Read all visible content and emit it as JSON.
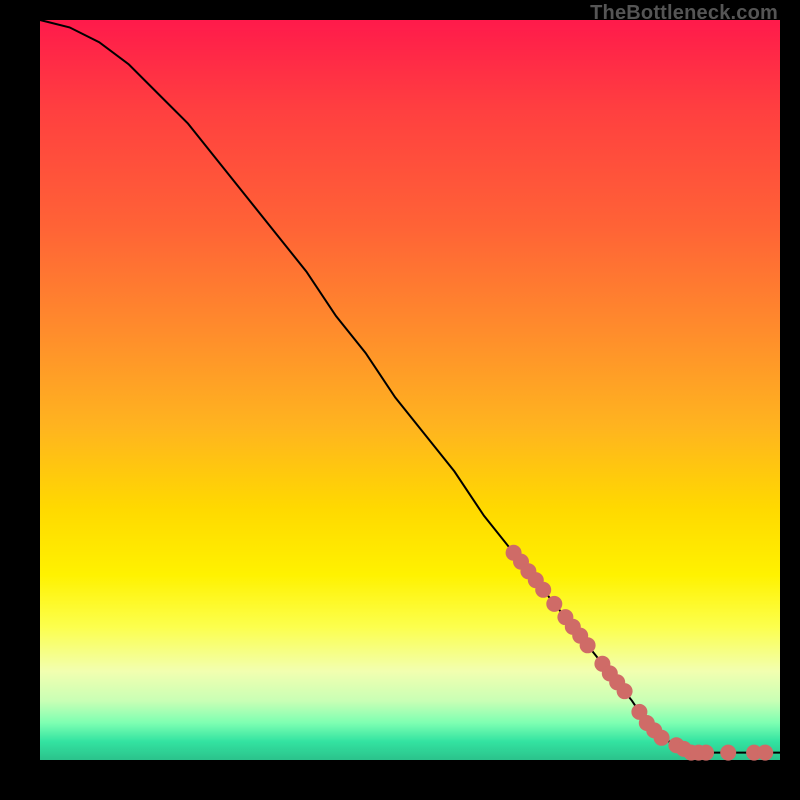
{
  "attribution": "TheBottleneck.com",
  "chart_data": {
    "type": "line",
    "title": "",
    "xlabel": "",
    "ylabel": "",
    "xlim": [
      0,
      100
    ],
    "ylim": [
      0,
      100
    ],
    "grid": false,
    "legend": false,
    "series": [
      {
        "name": "bottleneck-curve",
        "color": "#000000",
        "x": [
          0,
          4,
          8,
          12,
          16,
          20,
          24,
          28,
          32,
          36,
          40,
          44,
          48,
          52,
          56,
          60,
          64,
          68,
          72,
          76,
          80,
          82,
          84,
          86,
          88,
          90,
          92,
          94,
          96,
          98,
          100
        ],
        "y": [
          100,
          99,
          97,
          94,
          90,
          86,
          81,
          76,
          71,
          66,
          60,
          55,
          49,
          44,
          39,
          33,
          28,
          23,
          18,
          13,
          8,
          5,
          3,
          2,
          1,
          1,
          1,
          1,
          1,
          1,
          1
        ]
      }
    ],
    "markers": [
      {
        "name": "highlighted-segment",
        "color": "#cf6b67",
        "radius": 8,
        "points": [
          {
            "x": 64,
            "y": 28
          },
          {
            "x": 65,
            "y": 26.8
          },
          {
            "x": 66,
            "y": 25.5
          },
          {
            "x": 67,
            "y": 24.3
          },
          {
            "x": 68,
            "y": 23
          },
          {
            "x": 69.5,
            "y": 21.1
          },
          {
            "x": 71,
            "y": 19.3
          },
          {
            "x": 72,
            "y": 18
          },
          {
            "x": 73,
            "y": 16.8
          },
          {
            "x": 74,
            "y": 15.5
          },
          {
            "x": 76,
            "y": 13
          },
          {
            "x": 77,
            "y": 11.7
          },
          {
            "x": 78,
            "y": 10.5
          },
          {
            "x": 79,
            "y": 9.3
          },
          {
            "x": 81,
            "y": 6.5
          },
          {
            "x": 82,
            "y": 5
          },
          {
            "x": 83,
            "y": 4
          },
          {
            "x": 84,
            "y": 3
          },
          {
            "x": 86,
            "y": 2
          },
          {
            "x": 87,
            "y": 1.5
          },
          {
            "x": 88,
            "y": 1
          },
          {
            "x": 89,
            "y": 1
          },
          {
            "x": 90,
            "y": 1
          },
          {
            "x": 93,
            "y": 1
          },
          {
            "x": 96.5,
            "y": 1
          },
          {
            "x": 98,
            "y": 1
          }
        ]
      }
    ]
  }
}
